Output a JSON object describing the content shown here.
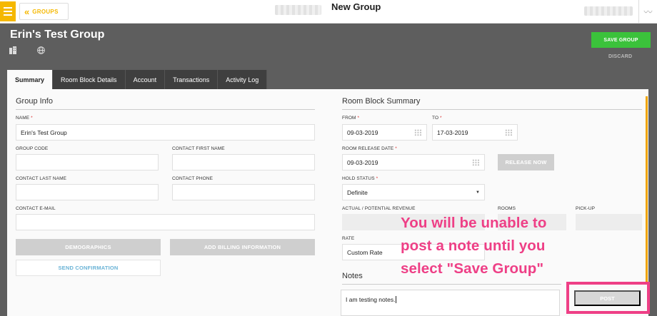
{
  "topbar": {
    "groups_label": "GROUPS",
    "title": "New Group"
  },
  "header": {
    "group_name": "Erin's Test Group",
    "save_label": "SAVE GROUP",
    "discard_label": "DISCARD"
  },
  "tabs": [
    {
      "label": "Summary"
    },
    {
      "label": "Room Block Details"
    },
    {
      "label": "Account"
    },
    {
      "label": "Transactions"
    },
    {
      "label": "Activity Log"
    }
  ],
  "group_info": {
    "title": "Group Info",
    "name_label": "NAME",
    "name_value": "Erin's Test Group",
    "group_code_label": "GROUP CODE",
    "contact_first_name_label": "CONTACT FIRST NAME",
    "contact_last_name_label": "CONTACT LAST NAME",
    "contact_phone_label": "CONTACT PHONE",
    "contact_email_label": "CONTACT E-MAIL",
    "demographics_label": "DEMOGRAPHICS",
    "billing_label": "ADD BILLING INFORMATION",
    "send_confirmation_label": "SEND CONFIRMATION"
  },
  "room_block": {
    "title": "Room Block Summary",
    "from_label": "FROM",
    "from_value": "09-03-2019",
    "to_label": "TO",
    "to_value": "17-03-2019",
    "release_date_label": "ROOM RELEASE DATE",
    "release_date_value": "09-03-2019",
    "release_now_label": "RELEASE NOW",
    "hold_status_label": "HOLD STATUS",
    "hold_status_value": "Definite",
    "revenue_label": "ACTUAL / POTENTIAL REVENUE",
    "rooms_label": "ROOMS",
    "pickup_label": "PICK-UP",
    "rate_label": "RATE",
    "rate_value": "Custom Rate"
  },
  "notes": {
    "title": "Notes",
    "value": "I am testing notes.",
    "post_label": "POST"
  },
  "annotation": {
    "line1": "You will be unable to",
    "line2": "post a note until you",
    "line3": "select \"Save Group\""
  },
  "colors": {
    "accent": "#f5b800",
    "save": "#3bc23b",
    "annotation": "#ee3f86"
  }
}
